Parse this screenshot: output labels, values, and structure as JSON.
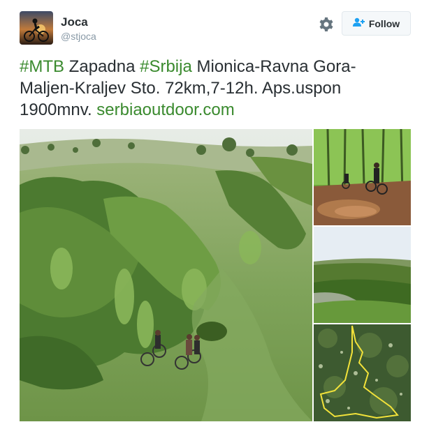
{
  "user": {
    "name": "Joca",
    "handle": "@stjoca"
  },
  "actions": {
    "follow_label": "Follow"
  },
  "tweet": {
    "tag1": "#MTB",
    "text1": " Zapadna ",
    "tag2": "#Srbija",
    "text2": " Mionica-Ravna Gora-Maljen-Kraljev Sto. 72km,7-12h. Aps.uspon 1900mnv. ",
    "link": "serbiaoutdoor.com"
  },
  "colors": {
    "accent": "#3a8a2e",
    "follow_icon": "#1da1f2"
  },
  "icons": [
    "gear-icon",
    "add-user-icon"
  ]
}
